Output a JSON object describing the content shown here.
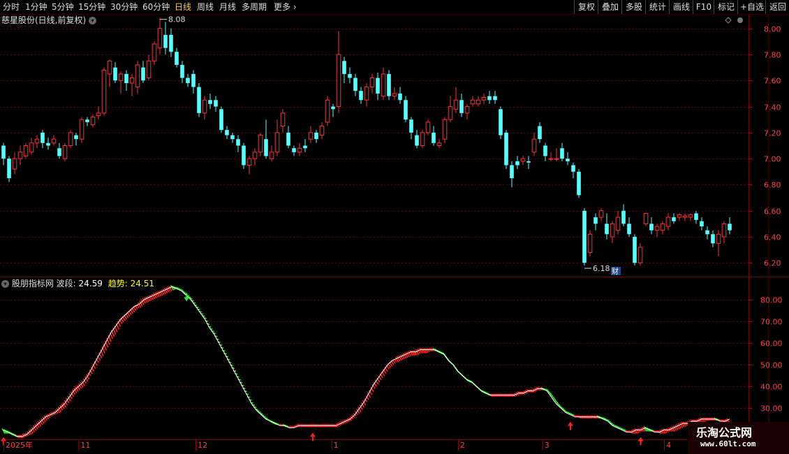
{
  "toolbar": {
    "periods": [
      "分时",
      "1分钟",
      "5分钟",
      "15分钟",
      "30分钟",
      "60分钟",
      "日线",
      "周线",
      "月线",
      "多周期",
      "更多"
    ],
    "active_period": "日线",
    "right_buttons": [
      "复权",
      "叠加",
      "多股",
      "统计",
      "画线",
      "F10",
      "标记",
      "+自选",
      "返回"
    ]
  },
  "main_header": {
    "title": "慈星股份(日线,前复权)"
  },
  "indicator_header": {
    "name": "股朋指标网",
    "wave_label": "波段:",
    "wave_value": "24.59",
    "trend_label": "趋势:",
    "trend_value": "24.51"
  },
  "watermark": {
    "title": "乐淘公式网",
    "url": "www.60lt.com"
  },
  "colors": {
    "up": "#ff3333",
    "down": "#54ffff",
    "grid": "#5a0000",
    "wave_up": "#ff2020",
    "wave_down": "#22ee22"
  },
  "chart_data": [
    {
      "type": "candlestick",
      "title": "慈星股份(日线,前复权)",
      "y_ticks": [
        6.2,
        6.4,
        6.6,
        6.8,
        7.0,
        7.2,
        7.4,
        7.6,
        7.8,
        8.0
      ],
      "ylim": [
        6.1,
        8.1
      ],
      "annotations": {
        "high": "8.08",
        "low": "6.18",
        "marker": "财"
      },
      "candles": [
        [
          7.1,
          7.0,
          7.12,
          6.95
        ],
        [
          7.0,
          6.85,
          7.02,
          6.82
        ],
        [
          6.92,
          7.0,
          7.05,
          6.88
        ],
        [
          7.0,
          7.05,
          7.1,
          6.95
        ],
        [
          7.02,
          7.1,
          7.12,
          7.0
        ],
        [
          7.05,
          7.12,
          7.16,
          7.03
        ],
        [
          7.12,
          7.15,
          7.18,
          7.08
        ],
        [
          7.2,
          7.12,
          7.22,
          7.08
        ],
        [
          7.12,
          7.1,
          7.16,
          7.07
        ],
        [
          7.12,
          7.15,
          7.18,
          7.1
        ],
        [
          7.08,
          7.02,
          7.12,
          7.0
        ],
        [
          7.0,
          7.1,
          7.12,
          6.98
        ],
        [
          7.1,
          7.2,
          7.22,
          7.08
        ],
        [
          7.18,
          7.15,
          7.2,
          7.1
        ],
        [
          7.15,
          7.3,
          7.32,
          7.12
        ],
        [
          7.3,
          7.28,
          7.32,
          7.25
        ],
        [
          7.26,
          7.32,
          7.34,
          7.24
        ],
        [
          7.33,
          7.35,
          7.4,
          7.3
        ],
        [
          7.35,
          7.68,
          7.7,
          7.33
        ],
        [
          7.65,
          7.75,
          7.76,
          7.55
        ],
        [
          7.7,
          7.6,
          7.74,
          7.58
        ],
        [
          7.6,
          7.65,
          7.67,
          7.5
        ],
        [
          7.65,
          7.58,
          7.68,
          7.52
        ],
        [
          7.58,
          7.62,
          7.65,
          7.48
        ],
        [
          7.55,
          7.72,
          7.75,
          7.5
        ],
        [
          7.7,
          7.6,
          7.75,
          7.58
        ],
        [
          7.62,
          7.75,
          7.8,
          7.6
        ],
        [
          7.75,
          7.88,
          7.9,
          7.72
        ],
        [
          7.85,
          8.0,
          8.08,
          7.8
        ],
        [
          7.95,
          7.85,
          8.05,
          7.8
        ],
        [
          7.95,
          7.82,
          8.0,
          7.78
        ],
        [
          7.82,
          7.72,
          7.85,
          7.7
        ],
        [
          7.72,
          7.62,
          7.75,
          7.58
        ],
        [
          7.62,
          7.58,
          7.65,
          7.55
        ],
        [
          7.65,
          7.55,
          7.68,
          7.5
        ],
        [
          7.55,
          7.35,
          7.58,
          7.32
        ],
        [
          7.35,
          7.45,
          7.48,
          7.3
        ],
        [
          7.45,
          7.42,
          7.5,
          7.38
        ],
        [
          7.45,
          7.4,
          7.48,
          7.36
        ],
        [
          7.38,
          7.22,
          7.4,
          7.2
        ],
        [
          7.22,
          7.18,
          7.25,
          7.15
        ],
        [
          7.18,
          7.15,
          7.2,
          7.12
        ],
        [
          7.15,
          7.1,
          7.18,
          7.05
        ],
        [
          7.1,
          6.95,
          7.12,
          6.92
        ],
        [
          6.95,
          7.0,
          7.02,
          6.88
        ],
        [
          7.0,
          7.05,
          7.08,
          6.95
        ],
        [
          7.05,
          7.18,
          7.2,
          7.02
        ],
        [
          7.15,
          7.02,
          7.3,
          7.0
        ],
        [
          7.0,
          7.05,
          7.1,
          6.98
        ],
        [
          7.05,
          7.2,
          7.3,
          7.02
        ],
        [
          7.25,
          7.35,
          7.38,
          7.2
        ],
        [
          7.2,
          7.1,
          7.25,
          7.08
        ],
        [
          7.08,
          7.05,
          7.1,
          7.02
        ],
        [
          7.05,
          7.08,
          7.12,
          7.02
        ],
        [
          7.1,
          7.08,
          7.15,
          7.05
        ],
        [
          7.15,
          7.2,
          7.25,
          7.12
        ],
        [
          7.2,
          7.15,
          7.22,
          7.12
        ],
        [
          7.18,
          7.25,
          7.28,
          7.15
        ],
        [
          7.28,
          7.45,
          7.48,
          7.25
        ],
        [
          7.4,
          7.38,
          7.42,
          7.32
        ],
        [
          7.4,
          7.8,
          7.98,
          7.35
        ],
        [
          7.75,
          7.65,
          7.78,
          7.58
        ],
        [
          7.65,
          7.62,
          7.7,
          7.58
        ],
        [
          7.62,
          7.52,
          7.65,
          7.48
        ],
        [
          7.52,
          7.45,
          7.55,
          7.42
        ],
        [
          7.45,
          7.55,
          7.58,
          7.4
        ],
        [
          7.55,
          7.62,
          7.65,
          7.5
        ],
        [
          7.62,
          7.5,
          7.66,
          7.45
        ],
        [
          7.48,
          7.65,
          7.7,
          7.45
        ],
        [
          7.65,
          7.48,
          7.68,
          7.45
        ],
        [
          7.48,
          7.5,
          7.55,
          7.45
        ],
        [
          7.5,
          7.45,
          7.55,
          7.42
        ],
        [
          7.45,
          7.3,
          7.48,
          7.28
        ],
        [
          7.3,
          7.2,
          7.32,
          7.15
        ],
        [
          7.18,
          7.1,
          7.22,
          7.08
        ],
        [
          7.1,
          7.2,
          7.22,
          7.08
        ],
        [
          7.2,
          7.28,
          7.3,
          7.18
        ],
        [
          7.2,
          7.12,
          7.25,
          7.1
        ],
        [
          7.1,
          7.12,
          7.15,
          7.08
        ],
        [
          7.15,
          7.3,
          7.32,
          7.12
        ],
        [
          7.3,
          7.4,
          7.48,
          7.28
        ],
        [
          7.38,
          7.45,
          7.55,
          7.35
        ],
        [
          7.45,
          7.35,
          7.5,
          7.32
        ],
        [
          7.35,
          7.4,
          7.42,
          7.3
        ],
        [
          7.42,
          7.45,
          7.48,
          7.4
        ],
        [
          7.42,
          7.45,
          7.48,
          7.4
        ],
        [
          7.45,
          7.47,
          7.5,
          7.42
        ],
        [
          7.48,
          7.45,
          7.52,
          7.42
        ],
        [
          7.48,
          7.45,
          7.52,
          7.42
        ],
        [
          7.38,
          7.18,
          7.4,
          7.15
        ],
        [
          7.2,
          6.95,
          7.22,
          6.92
        ],
        [
          6.95,
          6.85,
          6.98,
          6.78
        ],
        [
          6.98,
          6.95,
          7.02,
          6.92
        ],
        [
          6.98,
          7.0,
          7.02,
          6.95
        ],
        [
          6.98,
          6.97,
          7.02,
          6.92
        ],
        [
          7.05,
          7.15,
          7.2,
          7.02
        ],
        [
          7.25,
          7.15,
          7.28,
          7.12
        ],
        [
          7.1,
          7.02,
          7.12,
          6.98
        ],
        [
          7.0,
          7.0,
          7.05,
          6.98
        ],
        [
          7.0,
          7.0,
          7.08,
          6.98
        ],
        [
          7.08,
          7.0,
          7.12,
          6.98
        ],
        [
          7.0,
          6.98,
          7.05,
          6.95
        ],
        [
          6.95,
          6.9,
          6.97,
          6.85
        ],
        [
          6.9,
          6.72,
          6.92,
          6.7
        ],
        [
          6.6,
          6.2,
          6.62,
          6.18
        ],
        [
          6.28,
          6.42,
          6.45,
          6.25
        ],
        [
          6.55,
          6.5,
          6.58,
          6.45
        ],
        [
          6.55,
          6.6,
          6.62,
          6.52
        ],
        [
          6.5,
          6.42,
          6.58,
          6.38
        ],
        [
          6.4,
          6.5,
          6.52,
          6.35
        ],
        [
          6.45,
          6.55,
          6.6,
          6.42
        ],
        [
          6.6,
          6.5,
          6.65,
          6.48
        ],
        [
          6.5,
          6.42,
          6.55,
          6.4
        ],
        [
          6.4,
          6.2,
          6.42,
          6.18
        ],
        [
          6.2,
          6.32,
          6.35,
          6.18
        ],
        [
          6.5,
          6.58,
          6.58,
          6.48
        ],
        [
          6.5,
          6.45,
          6.55,
          6.42
        ],
        [
          6.45,
          6.48,
          6.5,
          6.4
        ],
        [
          6.45,
          6.5,
          6.52,
          6.42
        ],
        [
          6.48,
          6.55,
          6.58,
          6.45
        ],
        [
          6.55,
          6.52,
          6.58,
          6.5
        ],
        [
          6.55,
          6.57,
          6.58,
          6.52
        ],
        [
          6.55,
          6.56,
          6.58,
          6.52
        ],
        [
          6.55,
          6.57,
          6.58,
          6.52
        ],
        [
          6.58,
          6.53,
          6.6,
          6.5
        ],
        [
          6.52,
          6.48,
          6.55,
          6.45
        ],
        [
          6.45,
          6.42,
          6.48,
          6.38
        ],
        [
          6.42,
          6.35,
          6.45,
          6.32
        ],
        [
          6.35,
          6.42,
          6.45,
          6.25
        ],
        [
          6.4,
          6.5,
          6.52,
          6.35
        ],
        [
          6.5,
          6.45,
          6.55,
          6.42
        ]
      ]
    },
    {
      "type": "line",
      "title": "股朋指标网",
      "y_ticks": [
        30,
        40,
        50,
        60,
        70,
        80
      ],
      "ylim": [
        16,
        90
      ],
      "x_labels": [
        "2025年",
        "11",
        "12",
        "1",
        "2",
        "3",
        "4"
      ],
      "x_label_index": [
        0,
        16,
        41,
        70,
        97,
        115,
        141
      ],
      "series": [
        {
          "name": "波段",
          "values": [
            20,
            19,
            18,
            17,
            17,
            18,
            20,
            22,
            24,
            26,
            27,
            28,
            30,
            32,
            35,
            38,
            40,
            42,
            45,
            49,
            53,
            57,
            61,
            65,
            68,
            71,
            73,
            75,
            77,
            78,
            80,
            81,
            82,
            83,
            84,
            85,
            86,
            85,
            84,
            82,
            80,
            77,
            74,
            71,
            67,
            64,
            60,
            56,
            52,
            48,
            44,
            40,
            36,
            32,
            29,
            27,
            25,
            24,
            23,
            22,
            22,
            21,
            21,
            22,
            22,
            22,
            22,
            22,
            22,
            22,
            22,
            22,
            23,
            24,
            25,
            27,
            30,
            33,
            37,
            41,
            44,
            47,
            50,
            52,
            53,
            54,
            55,
            56,
            56,
            57,
            57,
            57,
            57,
            56,
            55,
            52,
            50,
            47,
            45,
            43,
            42,
            40,
            38,
            37,
            36,
            36,
            36,
            36,
            36,
            36,
            37,
            37,
            38,
            38,
            39,
            39,
            38,
            35,
            32,
            30,
            28,
            27,
            26,
            26,
            26,
            26,
            26,
            26,
            25,
            24,
            22,
            21,
            20,
            19,
            19,
            20,
            20,
            21,
            20,
            19,
            19,
            20,
            20,
            21,
            22,
            23,
            23,
            24,
            24,
            25,
            25,
            25,
            25,
            24,
            24,
            25
          ]
        },
        {
          "name": "趋势",
          "values": [
            19,
            19,
            18,
            17,
            17,
            18,
            19,
            21,
            23,
            25,
            27,
            28,
            29,
            31,
            34,
            37,
            39,
            41,
            44,
            47,
            51,
            54,
            58,
            62,
            65,
            69,
            71,
            73,
            75,
            77,
            79,
            80,
            81,
            82,
            83,
            84,
            85,
            86,
            85,
            83,
            81,
            78,
            75,
            72,
            68,
            65,
            61,
            57,
            53,
            49,
            45,
            41,
            37,
            33,
            30,
            28,
            26,
            24,
            23,
            23,
            22,
            22,
            22,
            22,
            22,
            22,
            22,
            22,
            22,
            22,
            22,
            22,
            23,
            24,
            25,
            27,
            29,
            32,
            35,
            39,
            42,
            45,
            48,
            50,
            52,
            53,
            54,
            55,
            55,
            56,
            56,
            57,
            57,
            56,
            55,
            52,
            50,
            47,
            45,
            43,
            42,
            40,
            38,
            37,
            36,
            36,
            36,
            36,
            36,
            36,
            37,
            37,
            38,
            38,
            39,
            39,
            39,
            37,
            34,
            31,
            29,
            28,
            27,
            26,
            26,
            26,
            26,
            26,
            26,
            25,
            23,
            22,
            21,
            20,
            19,
            19,
            20,
            20,
            20,
            20,
            19,
            19,
            20,
            20,
            21,
            22,
            23,
            24,
            24,
            24,
            25,
            25,
            25,
            25,
            24,
            24
          ]
        }
      ],
      "buy_signals": [
        0,
        66,
        121,
        136
      ],
      "sell_signals": [
        37
      ]
    }
  ]
}
